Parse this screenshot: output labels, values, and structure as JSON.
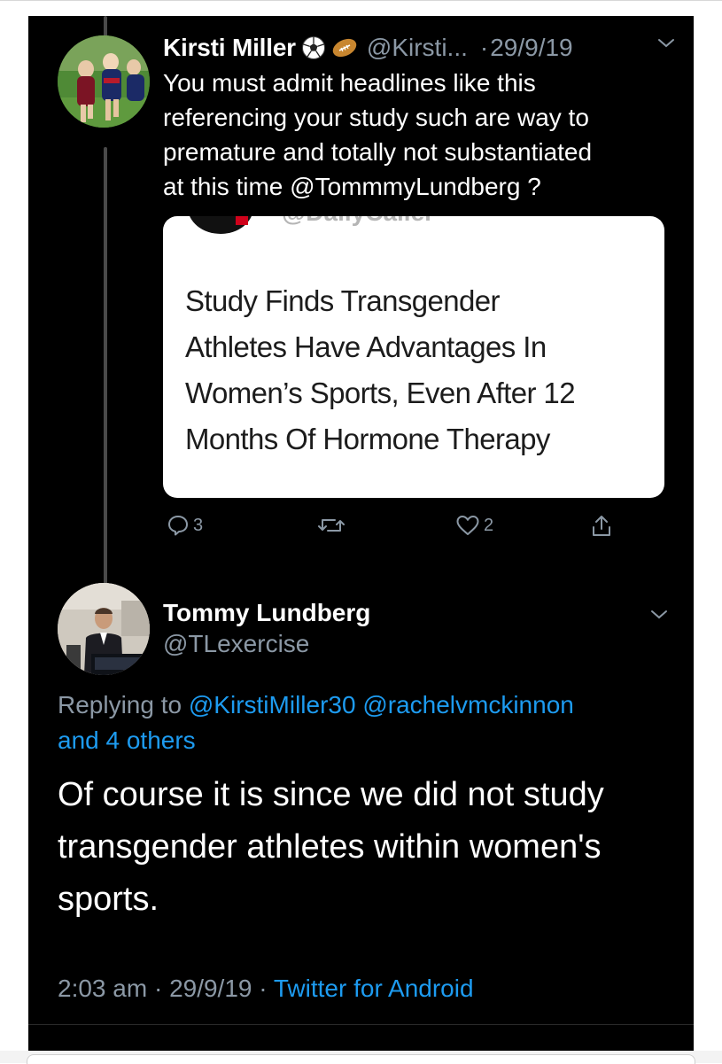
{
  "tweet1": {
    "author_name": "Kirsti Miller",
    "emojis": [
      "soccer-ball",
      "rugby-ball"
    ],
    "handle": "@Kirsti...",
    "separator": "·",
    "date": "29/9/19",
    "text": "You must admit headlines like this\nreferencing your study such are way to\npremature and totally not substantiated\nat this time @TommmyLundberg ?",
    "embedded_image": {
      "source_handle": "@DailyCaller",
      "headline": "Study Finds Transgender\nAthletes Have Advantages In\nWomen’s Sports, Even After 12\nMonths Of Hormone Therapy"
    },
    "actions": {
      "reply_count": "3",
      "retweet_count": "",
      "like_count": "2"
    }
  },
  "tweet2": {
    "author_name": "Tommy Lundberg",
    "handle": "@TLexercise",
    "replying_prefix": "Replying to",
    "replying_to_1": "@KirstiMiller30",
    "replying_to_2": "@rachelvmckinnon",
    "replying_others": "and 4 others",
    "body": "Of course it is since we did not study\ntransgender athletes within women's\nsports.",
    "time": "2:03 am",
    "date": "29/9/19",
    "separator": "·",
    "client": "Twitter for Android"
  },
  "colors": {
    "background": "#000000",
    "text_primary": "#ffffff",
    "text_secondary": "#8b98a5",
    "link": "#1d9bf0"
  }
}
